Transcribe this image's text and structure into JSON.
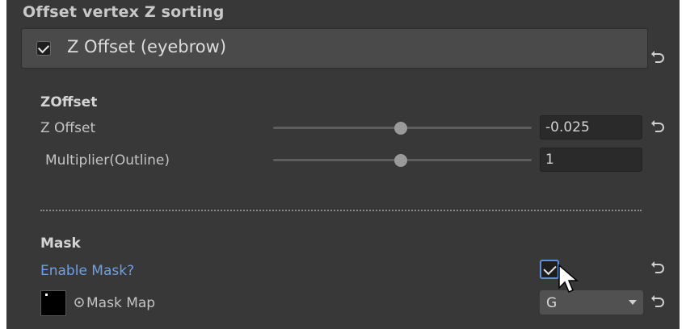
{
  "section_header": "Offset vertex Z sorting",
  "zoffset_toggle": {
    "label": "Z Offset (eyebrow)",
    "checked": true
  },
  "zoffset_group": {
    "title": "ZOffset",
    "z_offset": {
      "label": "Z Offset",
      "value": "-0.025",
      "slider_fraction": 0.5
    },
    "multiplier": {
      "label": "Multiplier(Outline)",
      "value": "1",
      "slider_fraction": 0.5
    }
  },
  "mask_group": {
    "title": "Mask",
    "enable_mask": {
      "label": "Enable Mask?",
      "checked": true
    },
    "mask_map": {
      "label": "Mask Map",
      "channel": "G"
    }
  },
  "icons": {
    "revert": "revert-arrow-icon",
    "object_picker": "object-picker-icon",
    "dropdown": "chevron-down-icon",
    "cursor": "mouse-pointer-icon"
  },
  "colors": {
    "background": "#383838",
    "header_bar": "#4a4a4a",
    "link": "#6f9fe6",
    "field": "#2a2a2a"
  }
}
